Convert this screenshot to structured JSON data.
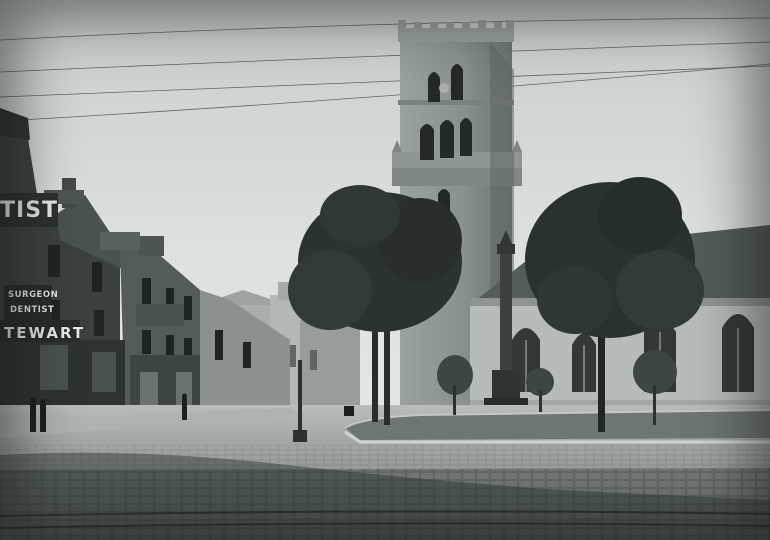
{
  "photo": {
    "subject": "",
    "tone": "monochrome"
  },
  "signs": {
    "tist": "TIST",
    "surgeon": "SURGEON",
    "dentist": "DENTIST",
    "stewart": "TEWART"
  },
  "colors": {
    "sky": "#d9ddda",
    "stone_dark": "#3d4441",
    "stone_mid": "#7f8784",
    "stone_light": "#b9bfbb",
    "foliage": "#2b332f",
    "cobbles": "#565d59"
  }
}
